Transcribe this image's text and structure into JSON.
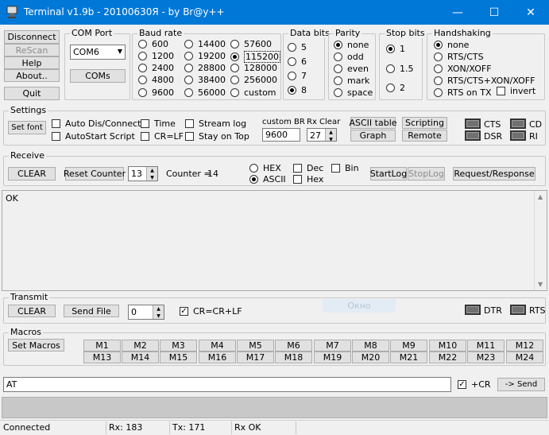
{
  "title_bar": {
    "title": "Terminal v1.9b - 20100630Я - by Br@y++",
    "min": "—",
    "max": "☐",
    "close": "✕"
  },
  "left_buttons": {
    "disconnect": "Disconnect",
    "rescan": "ReScan",
    "help": "Help",
    "about": "About..",
    "quit": "Quit"
  },
  "com_port": {
    "label": "COM Port",
    "value": "COM6",
    "coms_button": "COMs"
  },
  "baud_rate": {
    "label": "Baud rate",
    "options": [
      "600",
      "1200",
      "2400",
      "4800",
      "9600",
      "14400",
      "19200",
      "28800",
      "38400",
      "56000",
      "57600",
      "115200",
      "128000",
      "256000",
      "custom"
    ],
    "selected": "115200"
  },
  "data_bits": {
    "label": "Data bits",
    "options": [
      "5",
      "6",
      "7",
      "8"
    ],
    "selected": "8"
  },
  "parity": {
    "label": "Parity",
    "options": [
      "none",
      "odd",
      "even",
      "mark",
      "space"
    ],
    "selected": "none"
  },
  "stop_bits": {
    "label": "Stop bits",
    "options": [
      "1",
      "1.5",
      "2"
    ],
    "selected": "1"
  },
  "handshaking": {
    "label": "Handshaking",
    "options": [
      "none",
      "RTS/CTS",
      "XON/XOFF",
      "RTS/CTS+XON/XOFF",
      "RTS on TX"
    ],
    "selected": "none",
    "invert": "invert"
  },
  "settings": {
    "label": "Settings",
    "set_font": "Set font",
    "auto_dis_connect": "Auto Dis/Connect",
    "autostart_script": "AutoStart Script",
    "time": "Time",
    "cr_lf": "CR=LF",
    "stream_log": "Stream log",
    "stay_on_top": "Stay on Top",
    "custom_br_label": "custom BR",
    "custom_br_value": "9600",
    "rx_clear_label": "Rx Clear",
    "rx_clear_value": "27",
    "ascii_table": "ASCII table",
    "graph": "Graph",
    "scripting": "Scripting",
    "remote": "Remote",
    "leds": {
      "cts": "CTS",
      "cd": "CD",
      "dsr": "DSR",
      "ri": "RI"
    }
  },
  "receive": {
    "label": "Receive",
    "clear": "CLEAR",
    "reset_counter": "Reset Counter",
    "counter_spin": "13",
    "counter_label": "Counter =",
    "counter_value": "14",
    "hex": "HEX",
    "ascii": "ASCII",
    "mode_selected": "ASCII",
    "dec": "Dec",
    "hex_chk": "Hex",
    "bin": "Bin",
    "startlog": "StartLog",
    "stoplog": "StopLog",
    "request_response": "Request/Response",
    "output": "OK"
  },
  "transmit": {
    "label": "Transmit",
    "clear": "CLEAR",
    "send_file": "Send File",
    "spin_value": "0",
    "cr_crlf": "CR=CR+LF",
    "hidden_button": "Окно",
    "dtr": "DTR",
    "rts": "RTS"
  },
  "macros": {
    "label": "Macros",
    "set_macros": "Set Macros",
    "row1": [
      "M1",
      "M2",
      "M3",
      "M4",
      "M5",
      "M6",
      "M7",
      "M8",
      "M9",
      "M10",
      "M11",
      "M12"
    ],
    "row2": [
      "M13",
      "M14",
      "M15",
      "M16",
      "M17",
      "M18",
      "M19",
      "M20",
      "M21",
      "M22",
      "M23",
      "M24"
    ]
  },
  "command": {
    "value": "AT",
    "plus_cr": "+CR",
    "send": "-> Send"
  },
  "status": {
    "connected": "Connected",
    "rx": "Rx: 183",
    "tx": "Tx: 171",
    "rx_ok": "Rx OK"
  }
}
